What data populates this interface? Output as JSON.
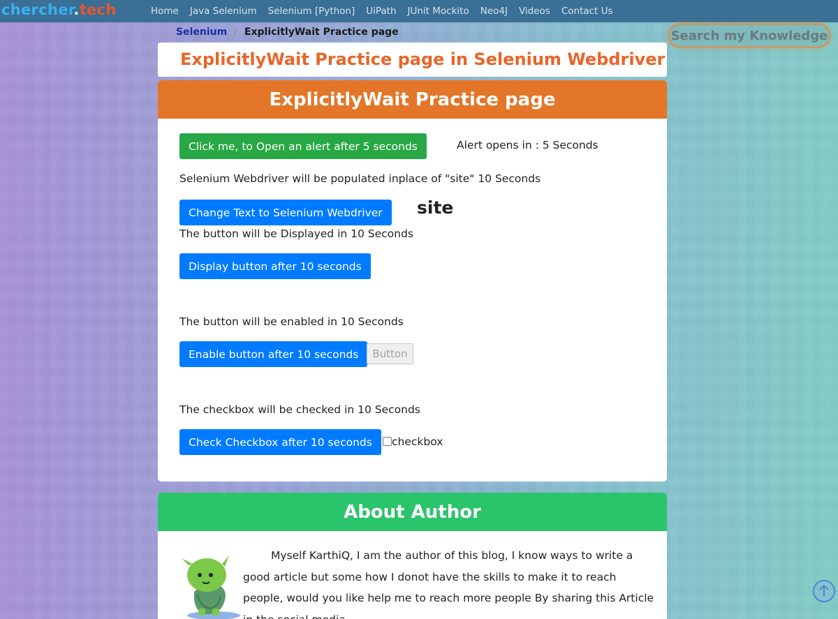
{
  "logo": {
    "part1": "chercher",
    "part2": ".",
    "part3": "tech"
  },
  "nav": {
    "items": [
      "Home",
      "Java Selenium",
      "Selenium [Python]",
      "UiPath",
      "JUnit Mockito",
      "Neo4J",
      "Videos",
      "Contact Us"
    ]
  },
  "breadcrumb": {
    "parent": "Selenium",
    "separator": "/",
    "current": "ExplicitlyWait Practice page"
  },
  "search": {
    "label": "Search my Knowledge"
  },
  "page_title": "ExplicitlyWait Practice page in Selenium Webdriver",
  "practice": {
    "header": "ExplicitlyWait Practice page",
    "alert_button": "Click me, to Open an alert after 5 seconds",
    "alert_info": "Alert opens in : 5 Seconds",
    "populate_info": "Selenium Webdriver will be populated inplace of \"site\" 10 Seconds",
    "change_text_button": "Change Text to Selenium Webdriver",
    "site_text": "site",
    "display_info": "The button will be Displayed in 10 Seconds",
    "display_button": "Display button after 10 seconds",
    "enable_info": "The button will be enabled in 10 Seconds",
    "enable_button": "Enable button after 10 seconds",
    "disabled_button": "Button",
    "checkbox_info": "The checkbox will be checked in 10 Seconds",
    "checkbox_button": "Check Checkbox after 10 seconds",
    "checkbox_label": "checkbox"
  },
  "about": {
    "header": "About Author",
    "text": "Myself KarthiQ, I am the author of this blog, I know ways to write a good article but some how I donot have the skills to make it to reach people, would you like help me to reach more people By sharing this Article in the social media."
  },
  "colors": {
    "nav_bg": "#3a6f96",
    "title_orange": "#e8652a",
    "practice_header": "#e37628",
    "about_header": "#2ac46b",
    "btn_green": "#28a745",
    "btn_blue": "#007bff"
  },
  "icons": {
    "scroll_top": "arrow-up-icon",
    "mascot": "mascot-icon"
  }
}
